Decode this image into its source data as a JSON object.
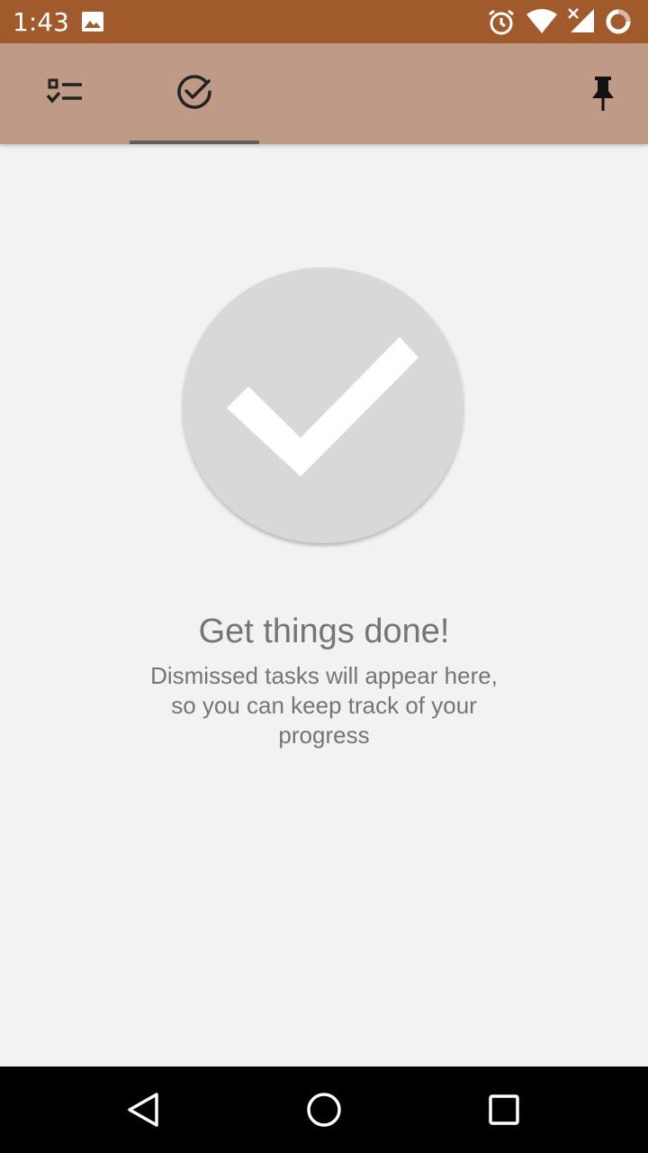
{
  "status_bar": {
    "time": "1:43",
    "icons": [
      "image-icon",
      "alarm-icon",
      "wifi-icon",
      "cell-signal-icon",
      "battery-icon"
    ],
    "background": "#a05a2c"
  },
  "toolbar": {
    "background": "#bf9a87",
    "tabs": [
      {
        "name": "tab-tasks",
        "icon": "checklist-icon",
        "selected": false
      },
      {
        "name": "tab-done",
        "icon": "check-circle-icon",
        "selected": true
      }
    ],
    "actions": [
      {
        "name": "pin-button",
        "icon": "pin-icon"
      }
    ]
  },
  "empty_state": {
    "icon": "big-check-icon",
    "title": "Get things done!",
    "subtitle": "Dismissed tasks will appear here, so you can keep track of your progress"
  },
  "navigation_bar": {
    "buttons": [
      "back-icon",
      "home-icon",
      "recents-icon"
    ]
  },
  "colors": {
    "accent": "#a05a2c",
    "toolbar": "#bf9a87",
    "page_background": "#f2f2f2",
    "text_secondary": "#757575"
  }
}
